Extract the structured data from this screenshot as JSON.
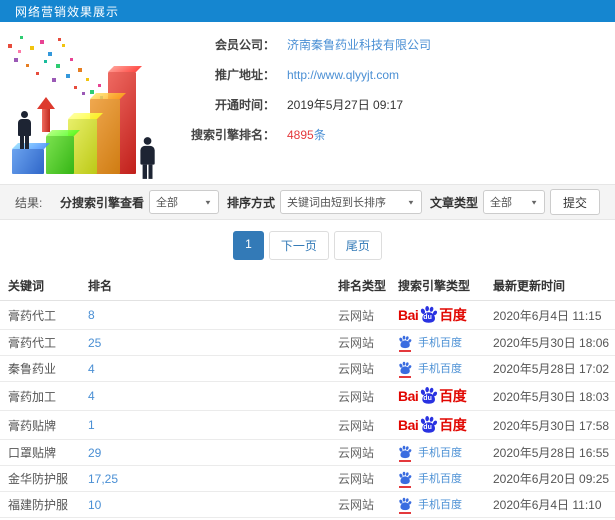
{
  "header": {
    "title": "网络营销效果展示"
  },
  "member": {
    "company_label": "会员公司：",
    "company_value": "济南秦鲁药业科技有限公司",
    "url_label": "推广地址：",
    "url_value": "http://www.qlyyjt.com",
    "open_time_label": "开通时间：",
    "open_time_value": "2019年5月27日 09:17",
    "rank_label": "搜索引擎排名：",
    "rank_count": "4895",
    "rank_unit": "条"
  },
  "filter": {
    "result_label": "结果:",
    "engine_filter_label": "分搜索引擎查看",
    "engine_filter_value": "全部",
    "sort_label": "排序方式",
    "sort_value": "关键词由短到长排序",
    "article_type_label": "文章类型",
    "article_type_value": "全部",
    "submit_label": "提交",
    "dropdown_icon": "▼"
  },
  "pagination": {
    "current": "1",
    "next": "下一页",
    "last": "尾页"
  },
  "table": {
    "columns": [
      "关键词",
      "排名",
      "排名类型",
      "搜索引擎类型",
      "最新更新时间"
    ],
    "baidu_logo": {
      "bai": "Bai",
      "du": "du",
      "cn": "百度"
    },
    "mobile_engine_label": "手机百度",
    "rows": [
      {
        "keyword": "膏药代工",
        "rank": "8",
        "rank_type": "云网站",
        "engine": "baidu",
        "update_time": "2020年6月4日 11:15"
      },
      {
        "keyword": "膏药代工",
        "rank": "25",
        "rank_type": "云网站",
        "engine": "mobile",
        "update_time": "2020年5月30日 18:06"
      },
      {
        "keyword": "秦鲁药业",
        "rank": "4",
        "rank_type": "云网站",
        "engine": "mobile",
        "update_time": "2020年5月28日 17:02"
      },
      {
        "keyword": "膏药加工",
        "rank": "4",
        "rank_type": "云网站",
        "engine": "baidu",
        "update_time": "2020年5月30日 18:03"
      },
      {
        "keyword": "膏药贴牌",
        "rank": "1",
        "rank_type": "云网站",
        "engine": "baidu",
        "update_time": "2020年5月30日 17:58"
      },
      {
        "keyword": "口罩贴牌",
        "rank": "29",
        "rank_type": "云网站",
        "engine": "mobile",
        "update_time": "2020年5月28日 16:55"
      },
      {
        "keyword": "金华防护服",
        "rank": "17,25",
        "rank_type": "云网站",
        "engine": "mobile",
        "update_time": "2020年6月20日 09:25"
      },
      {
        "keyword": "福建防护服",
        "rank": "10",
        "rank_type": "云网站",
        "engine": "mobile",
        "update_time": "2020年6月4日 11:10"
      }
    ]
  },
  "colors": {
    "header_blue": "#1586d0",
    "link_blue": "#4a8fd4",
    "highlight_red": "#e4393c",
    "pagination_active": "#337ab7",
    "baidu_red": "#e10601",
    "baidu_blue": "#2932e1"
  }
}
